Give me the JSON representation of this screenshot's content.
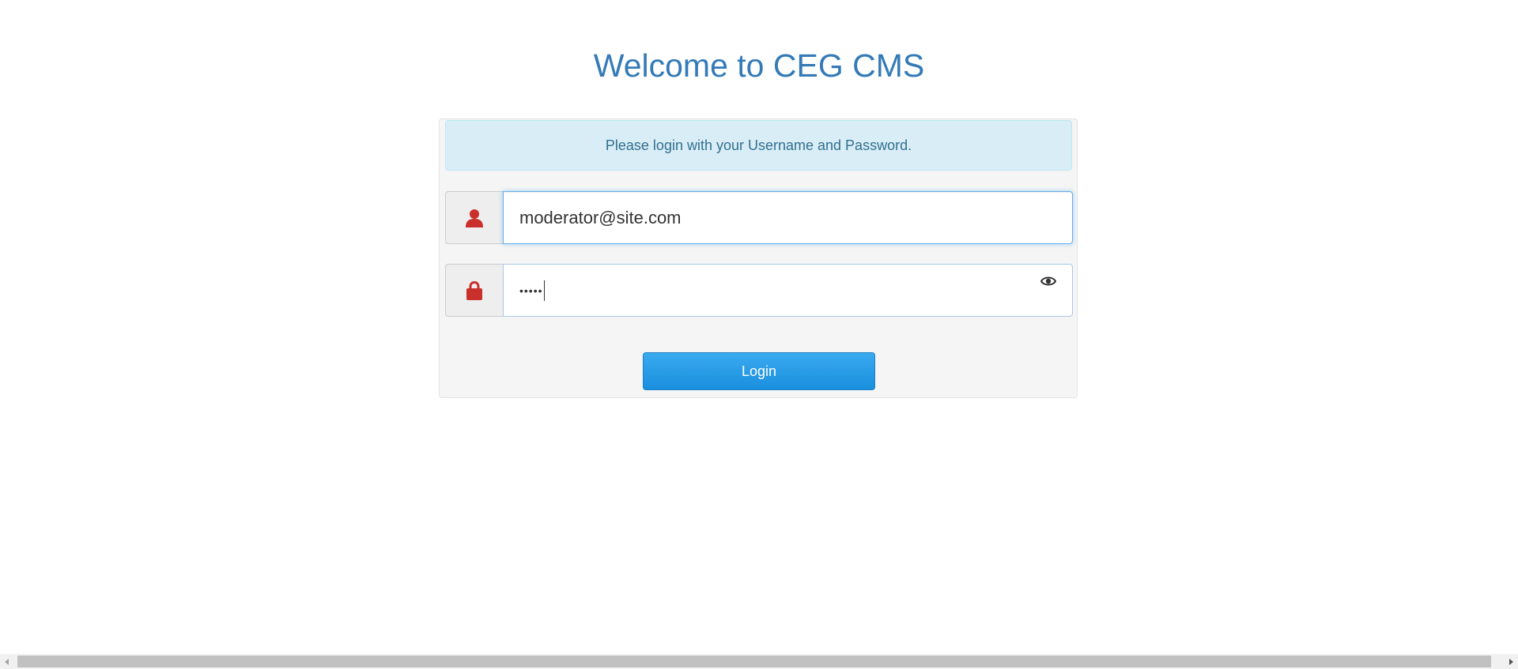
{
  "page": {
    "title": "Welcome to CEG CMS"
  },
  "login_panel": {
    "info_message": "Please login with your Username and Password.",
    "username": {
      "value": "moderator@site.com",
      "icon": "user-icon"
    },
    "password": {
      "masked_value": "•••••",
      "icon": "lock-icon",
      "toggle_icon": "eye-icon"
    },
    "login_label": "Login"
  },
  "colors": {
    "title": "#337ab7",
    "info_bg": "#d9edf7",
    "info_text": "#31708f",
    "icon_red": "#c9302c",
    "button_blue": "#2a9be8"
  }
}
